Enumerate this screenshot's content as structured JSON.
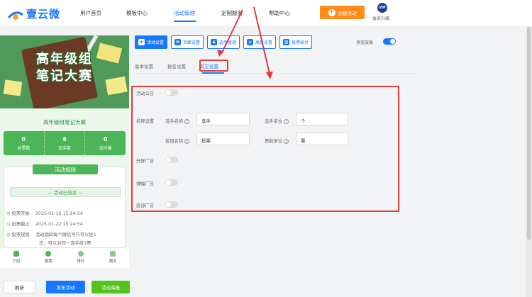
{
  "brand": {
    "name": "壹云微"
  },
  "nav": {
    "items": [
      "用户首页",
      "模板中心",
      "活动管理",
      "定制服务",
      "帮助中心"
    ],
    "active_index": 2,
    "create_label": "创建活动",
    "vip_badge": "VIP",
    "vip_label": "会员升级"
  },
  "preview": {
    "banner_line1": "高年级组",
    "banner_line2": "笔记大赛",
    "contest_name": "高年级组笔记大赛",
    "stats": [
      {
        "value": "0",
        "label": "总票数"
      },
      {
        "value": "6",
        "label": "选手数"
      },
      {
        "value": "0",
        "label": "访问量"
      }
    ],
    "rules_title": "活动规则",
    "ended_text": "— 活动已结束 —",
    "rules": [
      {
        "label": "投票开始:",
        "value": "2025-01-16 15:24:54"
      },
      {
        "label": "投票截止:",
        "value": "2025-01-22 15:24:54"
      },
      {
        "label": "投票规则:",
        "value": "活动期间每个微信号只可以投1"
      },
      {
        "label": "",
        "value": "次，可以对同一选手投1票"
      }
    ],
    "tabs": [
      "介绍",
      "投票",
      "排行",
      "报名"
    ],
    "buttons": {
      "refresh": "刷新",
      "publish": "发布活动",
      "poster": "活动海报"
    }
  },
  "settings": {
    "buttons": [
      {
        "label": "活动设置",
        "icon": "star-icon"
      },
      {
        "label": "页面设置",
        "icon": "gear-icon"
      },
      {
        "label": "选手管理",
        "icon": "users-icon"
      },
      {
        "label": "高级设置",
        "icon": "sliders-icon"
      },
      {
        "label": "投票统计",
        "icon": "chart-icon"
      }
    ],
    "active_button": 0,
    "preview_label": "预览效果",
    "preview_on": true,
    "subtabs": [
      "基本设置",
      "报名设置",
      "其它设置"
    ],
    "active_subtab": 2
  },
  "other_settings": {
    "announcement_label": "活动公告",
    "announcement_on": false,
    "naming_label": "名称设置",
    "contestant_name_label": "选手名称",
    "contestant_name_value": "选手",
    "contestant_unit_label": "选手单位",
    "contestant_unit_value": "个",
    "button_name_label": "按钮名称",
    "button_name_value": "投票",
    "vote_unit_label": "票数单位",
    "vote_unit_value": "票",
    "help_mark": "?",
    "splash_ad_label": "开屏广告",
    "splash_ad_on": false,
    "popup_ad_label": "弹幅广告",
    "popup_ad_on": false,
    "bottom_ad_label": "底部广告",
    "bottom_ad_on": false
  },
  "colors": {
    "accent": "#1677ff",
    "orange": "#ff8c1a",
    "green": "#4cb557",
    "annotation_red": "#e63b3b"
  }
}
